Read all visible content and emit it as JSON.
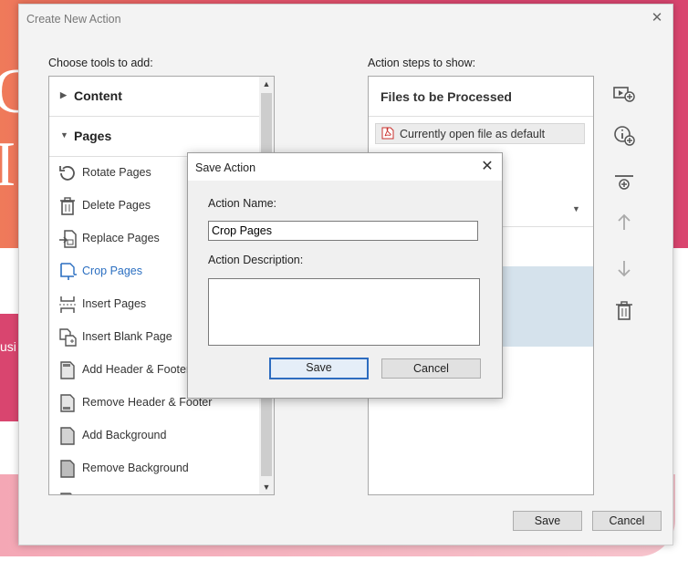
{
  "background": {
    "letters": [
      "C",
      "I"
    ],
    "partial_text": "usi"
  },
  "main_dialog": {
    "title": "Create New Action",
    "close_glyph": "✕",
    "left_label": "Choose tools to add:",
    "right_label": "Action steps to show:",
    "groups": [
      {
        "label": "Content",
        "expanded": false
      },
      {
        "label": "Pages",
        "expanded": true
      }
    ],
    "tools": [
      {
        "label": "Rotate Pages",
        "icon": "rotate-icon"
      },
      {
        "label": "Delete Pages",
        "icon": "trash-icon"
      },
      {
        "label": "Replace Pages",
        "icon": "replace-pages-icon"
      },
      {
        "label": "Crop Pages",
        "icon": "crop-icon",
        "active": true
      },
      {
        "label": "Insert Pages",
        "icon": "insert-pages-icon"
      },
      {
        "label": "Insert Blank Page",
        "icon": "insert-blank-page-icon"
      },
      {
        "label": "Add Header & Footer",
        "icon": "document-icon"
      },
      {
        "label": "Remove Header & Footer",
        "icon": "document-icon"
      },
      {
        "label": "Add Background",
        "icon": "document-icon"
      },
      {
        "label": "Remove Background",
        "icon": "document-icon"
      }
    ],
    "files_heading": "Files to be Processed",
    "default_file": "Currently open file as default",
    "save_label": "Save",
    "cancel_label": "Cancel",
    "side_tools": [
      "add-file-icon",
      "add-info-icon",
      "insert-divider-icon",
      "move-up-icon",
      "move-down-icon",
      "delete-icon"
    ],
    "accent_color": "#2b6fc1"
  },
  "save_dialog": {
    "title": "Save Action",
    "close_glyph": "✕",
    "name_label": "Action Name:",
    "name_value": "Crop Pages",
    "description_label": "Action Description:",
    "description_value": "",
    "save_label": "Save",
    "cancel_label": "Cancel"
  }
}
